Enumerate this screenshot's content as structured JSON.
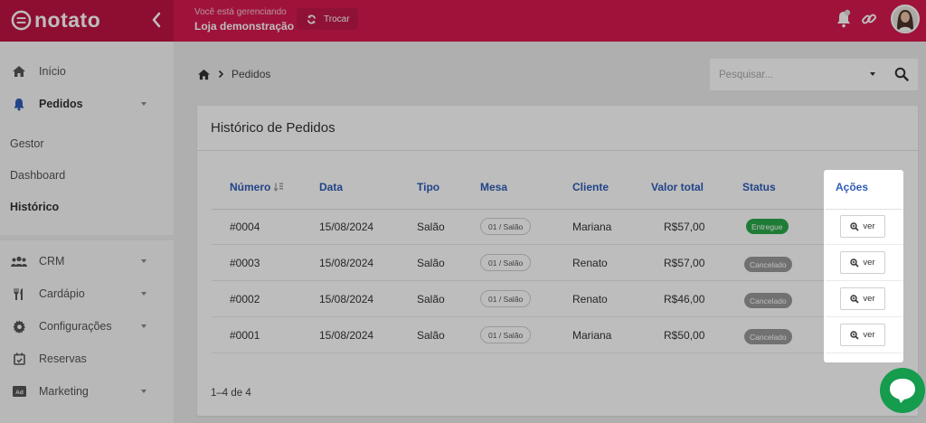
{
  "brand": {
    "name": "notato"
  },
  "header": {
    "manage_label": "Você está gerenciando",
    "store_name": "Loja demonstração",
    "switch_label": "Trocar"
  },
  "sidebar": {
    "items": [
      {
        "label": "Início",
        "icon": "home-icon"
      },
      {
        "label": "Pedidos",
        "icon": "bell-icon"
      },
      {
        "label": "CRM",
        "icon": "users-icon"
      },
      {
        "label": "Cardápio",
        "icon": "utensils-icon"
      },
      {
        "label": "Configurações",
        "icon": "gear-icon"
      },
      {
        "label": "Reservas",
        "icon": "calendar-check-icon"
      },
      {
        "label": "Marketing",
        "icon": "ad-icon"
      }
    ],
    "sub_items": [
      "Gestor",
      "Dashboard",
      "Histórico"
    ]
  },
  "breadcrumb": {
    "current": "Pedidos"
  },
  "search": {
    "placeholder": "Pesquisar..."
  },
  "card": {
    "title": "Histórico de Pedidos"
  },
  "table": {
    "headers": [
      "Número",
      "Data",
      "Tipo",
      "Mesa",
      "Cliente",
      "Valor total",
      "Status",
      "Ações"
    ],
    "rows": [
      {
        "numero": "#0004",
        "data": "15/08/2024",
        "tipo": "Salão",
        "mesa": "01 / Salão",
        "cliente": "Mariana",
        "valor": "R$57,00",
        "status": "Entregue",
        "acao": "ver"
      },
      {
        "numero": "#0003",
        "data": "15/08/2024",
        "tipo": "Salão",
        "mesa": "01 / Salão",
        "cliente": "Renato",
        "valor": "R$57,00",
        "status": "Cancelado",
        "acao": "ver"
      },
      {
        "numero": "#0002",
        "data": "15/08/2024",
        "tipo": "Salão",
        "mesa": "01 / Salão",
        "cliente": "Renato",
        "valor": "R$46,00",
        "status": "Cancelado",
        "acao": "ver"
      },
      {
        "numero": "#0001",
        "data": "15/08/2024",
        "tipo": "Salão",
        "mesa": "01 / Salão",
        "cliente": "Mariana",
        "valor": "R$50,00",
        "status": "Cancelado",
        "acao": "ver"
      }
    ]
  },
  "pagination": {
    "text": "1–4 de 4"
  },
  "colors": {
    "topbar": "#d71a4f",
    "header_text": "#2f5cb8",
    "status_entregue": "#2ba84a",
    "status_cancelado": "#999999",
    "chat": "#159c4d"
  }
}
